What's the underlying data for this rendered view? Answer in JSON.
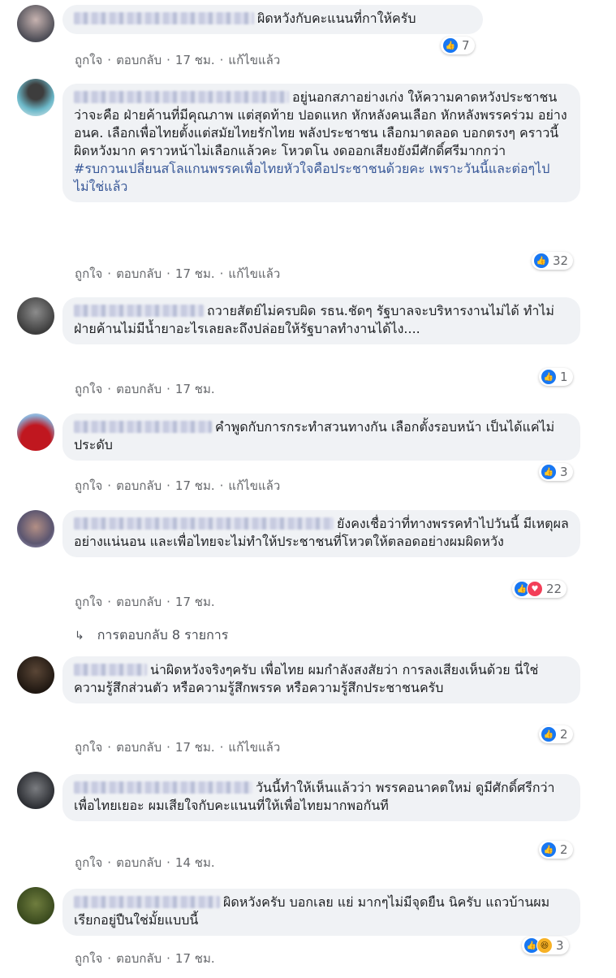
{
  "comments": [
    {
      "text": "ผิดหวังกับคะแนนที่กาให้ครับ",
      "like": "ถูกใจ",
      "reply": "ตอบกลับ",
      "time": "17 ชม.",
      "edited": "แก้ไขแล้ว",
      "count": "7"
    },
    {
      "text": "อยู่นอกสภาอย่างเก่ง ให้ความคาดหวังประชาชน ว่าจะคือ ฝ่ายค้านที่มีคุณภาพ แต่สุดท้าย ปอดแหก หักหลังคนเลือก หักหลังพรรคร่วม อย่าง อนค. เลือกเพื่อไทยตั้งแต่สมัยไทยรักไทย พลังประชาชน เลือกมาตลอด บอกตรงๆ คราวนี้ผิดหวังมาก คราวหน้าไม่เลือกแล้วคะ โหวตโน งดออกเสียงยังมีศักดิ์ศรีมากกว่า",
      "hashtag": "#รบกวนเปลี่ยนสโลแกนพรรคเพื่อไทยหัวใจคือประชาชนด้วยคะ เพราะวันนี้และต่อๆไปไม่ใช่แล้ว",
      "like": "ถูกใจ",
      "reply": "ตอบกลับ",
      "time": "17 ชม.",
      "edited": "แก้ไขแล้ว",
      "count": "32"
    },
    {
      "text": "ถวายสัตย์ไม่ครบผิด รธน.ชัดๆ รัฐบาลจะบริหารงานไม่ได้ ทำไม่ฝ่ายค้านไม่มีน้ำยาอะไรเลยละถึงปล่อยให้รัฐบาลทำงานได้ไง....",
      "like": "ถูกใจ",
      "reply": "ตอบกลับ",
      "time": "17 ชม.",
      "count": "1"
    },
    {
      "text": "คำพูดกับการกระทำสวนทางกัน เลือกตั้งรอบหน้า เป็นได้แค่ไม่ประดับ",
      "like": "ถูกใจ",
      "reply": "ตอบกลับ",
      "time": "17 ชม.",
      "edited": "แก้ไขแล้ว",
      "count": "3"
    },
    {
      "text": "ยังคงเชื่อว่าที่ทางพรรคทำไปวันนี้ มีเหตุผล อย่างแน่นอน และเพื่อไทยจะไม่ทำให้ประชาชนที่โหวตให้ตลอดอย่างผมผิดหวัง",
      "like": "ถูกใจ",
      "reply": "ตอบกลับ",
      "time": "17 ชม.",
      "count": "22",
      "replies": "การตอบกลับ 8 รายการ"
    },
    {
      "text": "น่าผิดหวังจริงๆครับ เพื่อไทย ผมกำลังสงสัยว่า การลงเสียงเห็นด้วย นี่ใช่ความรู้สึกส่วนตัว หรือความรู้สึกพรรค หรือความรู้สึกประชาชนครับ",
      "like": "ถูกใจ",
      "reply": "ตอบกลับ",
      "time": "17 ชม.",
      "edited": "แก้ไขแล้ว",
      "count": "2"
    },
    {
      "text": "วันนี้ทำให้เห็นแล้วว่า พรรคอนาคตใหม่ ดูมีศักดิ์ศรีกว่าเพื่อไทยเยอะ ผมเสียใจกับคะแนนที่ให้เพื่อไทยมากพอกันที",
      "like": "ถูกใจ",
      "reply": "ตอบกลับ",
      "time": "14 ชม.",
      "count": "2"
    },
    {
      "text": "ผิดหวังครับ บอกเลย แย่ มากๆไม่มีจุดยืน นิครับ แถวบ้านผมเรียกอยู่ปืนใช่มั้ยแบบนี้",
      "like": "ถูกใจ",
      "reply": "ตอบกลับ",
      "time": "17 ชม.",
      "count": "3"
    }
  ],
  "colors": {
    "bubble": "#f0f2f5",
    "like": "#1877f2",
    "love": "#f33e58",
    "haha": "#f7b125",
    "hashtag": "#385898",
    "meta": "#65676b"
  }
}
